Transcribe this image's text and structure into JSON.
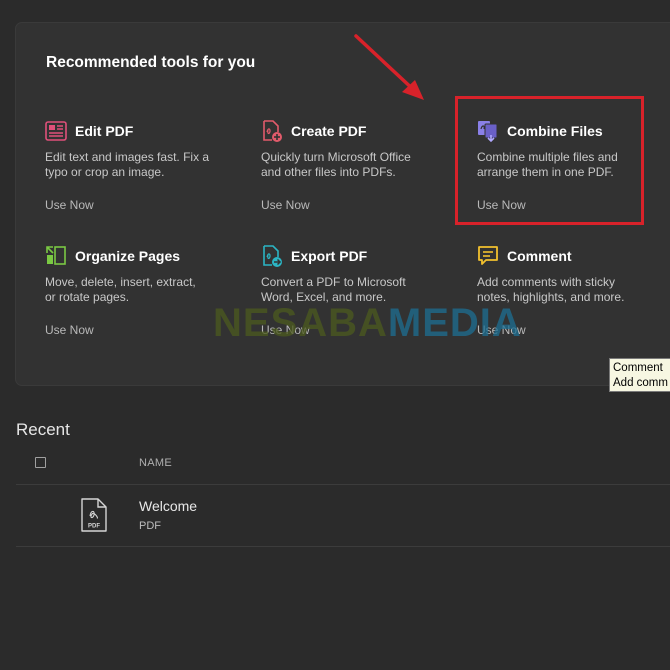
{
  "panel": {
    "title": "Recommended tools for you"
  },
  "tools": [
    {
      "name": "Edit PDF",
      "desc_1": "Edit text and images fast. Fix a",
      "desc_2": "typo or crop an image.",
      "link": "Use Now",
      "icon": "edit-pdf-icon",
      "color": "#e0507a"
    },
    {
      "name": "Create PDF",
      "desc_1": "Quickly turn Microsoft Office",
      "desc_2": "and other files into PDFs.",
      "link": "Use Now",
      "icon": "create-pdf-icon",
      "color": "#e25b6b"
    },
    {
      "name": "Combine Files",
      "desc_1": "Combine multiple files and",
      "desc_2": "arrange them in one PDF.",
      "link": "Use Now",
      "icon": "combine-files-icon",
      "color": "#8a80e8"
    },
    {
      "name": "Organize Pages",
      "desc_1": "Move, delete, insert, extract,",
      "desc_2": "or rotate pages.",
      "link": "Use Now",
      "icon": "organize-pages-icon",
      "color": "#7ac943"
    },
    {
      "name": "Export PDF",
      "desc_1": "Convert a PDF to Microsoft",
      "desc_2": "Word, Excel, and more.",
      "link": "Use Now",
      "icon": "export-pdf-icon",
      "color": "#2bb5c4"
    },
    {
      "name": "Comment",
      "desc_1": "Add comments with sticky",
      "desc_2": "notes, highlights, and more.",
      "link": "Use Now",
      "icon": "comment-icon",
      "color": "#f2c12e"
    }
  ],
  "tooltip": {
    "line_1": "Comment",
    "line_2": "Add comm"
  },
  "watermark": {
    "part_1": "NESABA",
    "part_2": "MEDIA"
  },
  "recent": {
    "title": "Recent",
    "column_name": "NAME",
    "files": [
      {
        "name": "Welcome",
        "type": "PDF",
        "icon_label": "PDF"
      }
    ]
  },
  "colors": {
    "highlight": "#d8222a",
    "background": "#2b2b2b",
    "panel": "#323232"
  }
}
